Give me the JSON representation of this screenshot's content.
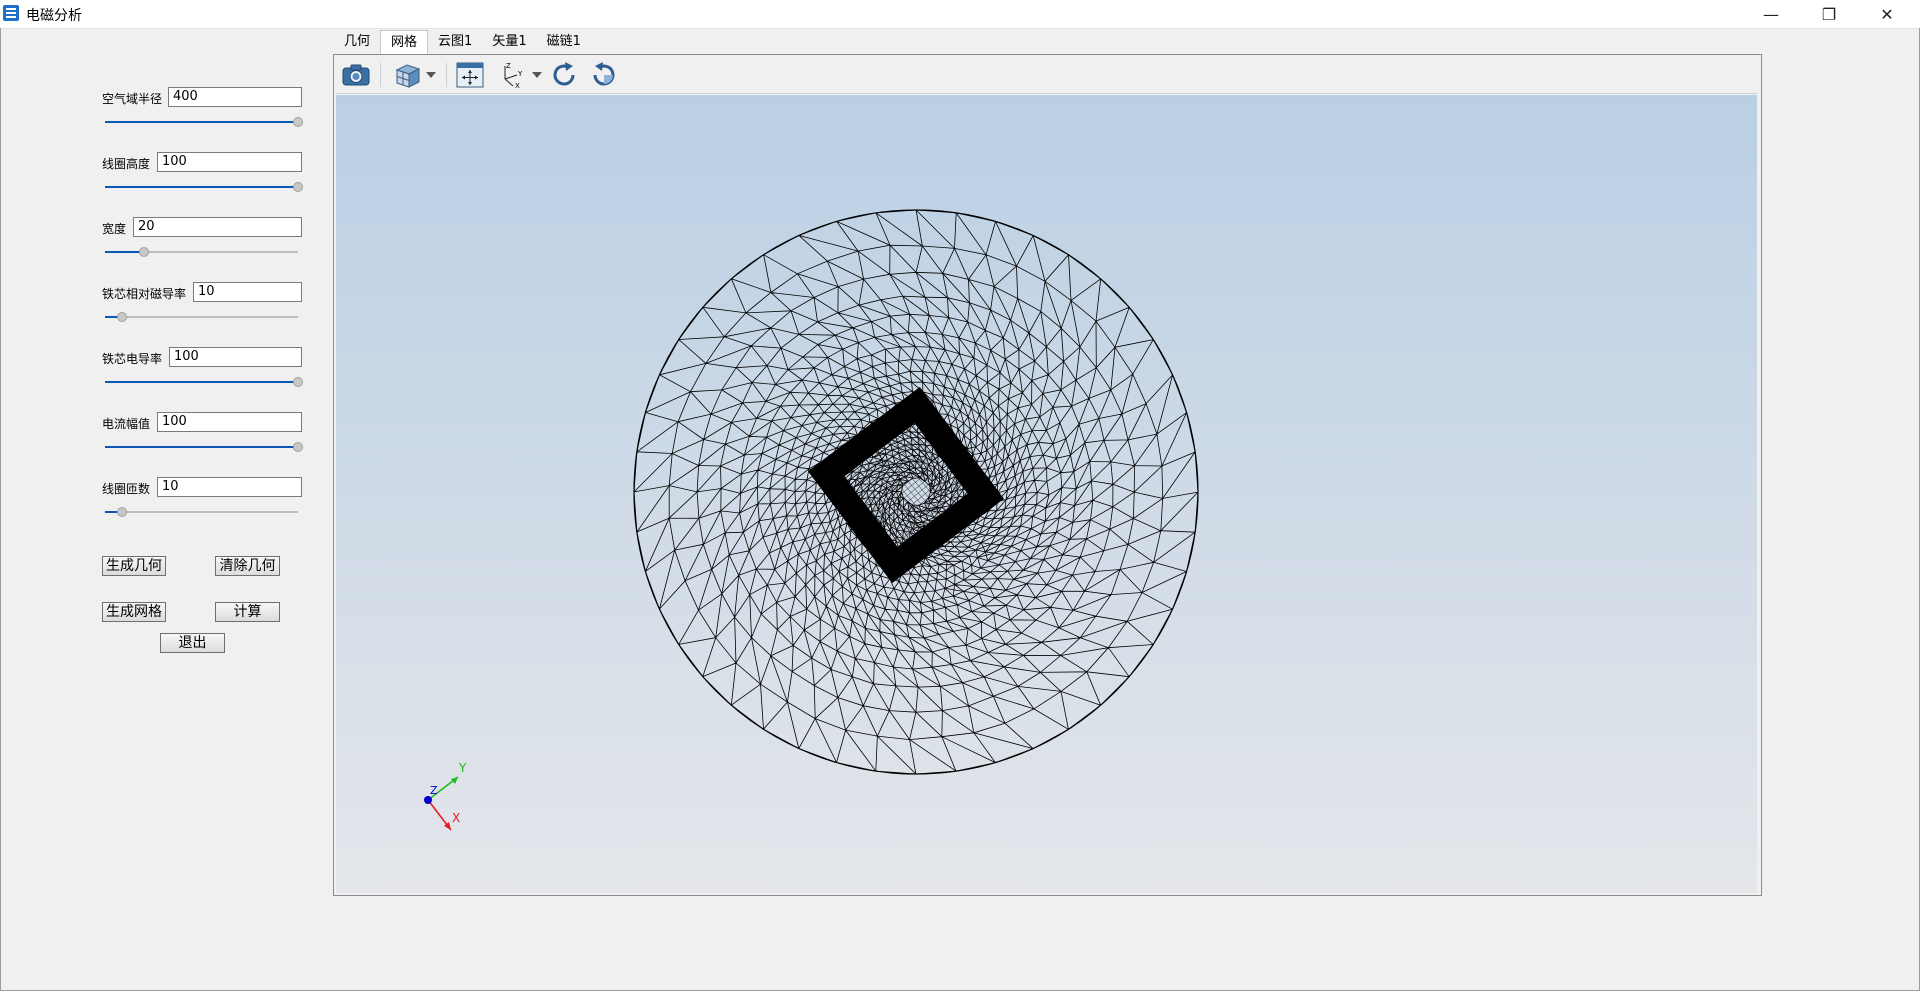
{
  "window": {
    "title": "电磁分析",
    "minimize": "—",
    "maximize": "❐",
    "close": "✕"
  },
  "params": [
    {
      "label": "空气域半径",
      "value": "400",
      "slider": 1.0
    },
    {
      "label": "线圈高度",
      "value": "100",
      "slider": 1.0
    },
    {
      "label": "宽度",
      "value": "20",
      "slider": 0.2
    },
    {
      "label": "铁芯相对磁导率",
      "value": "10",
      "slider": 0.09
    },
    {
      "label": "铁芯电导率",
      "value": "100",
      "slider": 1.0
    },
    {
      "label": "电流幅值",
      "value": "100",
      "slider": 1.0
    },
    {
      "label": "线圈匝数",
      "value": "10",
      "slider": 0.09
    }
  ],
  "buttons": {
    "gen_geometry": "生成几何",
    "clear_geometry": "清除几何",
    "gen_mesh": "生成网格",
    "compute": "计算",
    "exit": "退出"
  },
  "tabs": [
    {
      "label": "几何",
      "active": false
    },
    {
      "label": "网格",
      "active": true
    },
    {
      "label": "云图1",
      "active": false
    },
    {
      "label": "矢量1",
      "active": false
    },
    {
      "label": "磁链1",
      "active": false
    }
  ],
  "axes": {
    "x": "X",
    "y": "Y",
    "z": "Z"
  },
  "colors": {
    "x_axis": "#e31a1c",
    "y_axis": "#1dbb1d",
    "z_axis": "#0000cc",
    "slider_fill": "#0a59b4"
  }
}
